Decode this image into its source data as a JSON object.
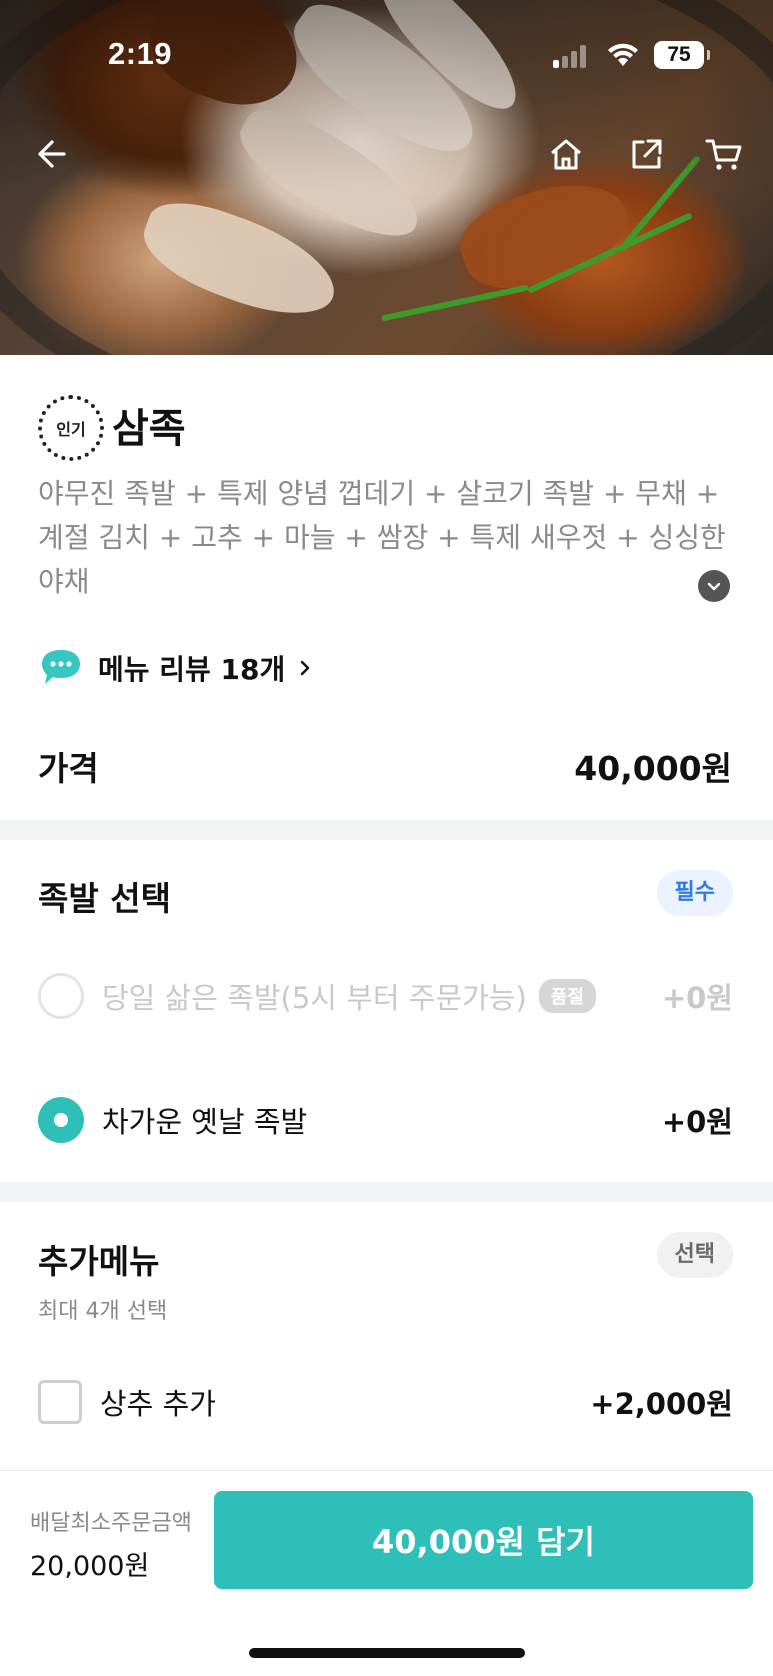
{
  "status_bar": {
    "time": "2:19",
    "battery": "75"
  },
  "nav": {
    "back": "back-arrow-icon",
    "home": "home-icon",
    "share": "share-icon",
    "cart": "cart-icon"
  },
  "product": {
    "badge": "인기",
    "name": "삼족",
    "description": "야무진 족발 + 특제 양념 껍데기 + 살코기 족발 + 무채 + 계절 김치 + 고추 + 마늘 + 쌈장 + 특제 새우젓 + 싱싱한 야채",
    "review_link": "메뉴 리뷰 18개",
    "price_label": "가격",
    "price": "40,000원"
  },
  "option_group_1": {
    "title": "족발 선택",
    "tag": "필수",
    "options": [
      {
        "label": "당일 삶은 족발(5시 부터 주문가능)",
        "badge": "품절",
        "price": "+0원",
        "disabled": true,
        "selected": false
      },
      {
        "label": "차가운 옛날 족발",
        "price": "+0원",
        "disabled": false,
        "selected": true
      }
    ]
  },
  "option_group_2": {
    "title": "추가메뉴",
    "tag": "선택",
    "subtitle": "최대 4개 선택",
    "options": [
      {
        "label": "상추 추가",
        "price": "+2,000원",
        "checked": false
      }
    ]
  },
  "bottom_bar": {
    "min_order_label": "배달최소주문금액",
    "min_order_value": "20,000원",
    "add_button": "40,000원 담기"
  },
  "colors": {
    "accent": "#2ec0b8",
    "required_tag": "#2f7be6",
    "divider": "#f2f3f4"
  }
}
